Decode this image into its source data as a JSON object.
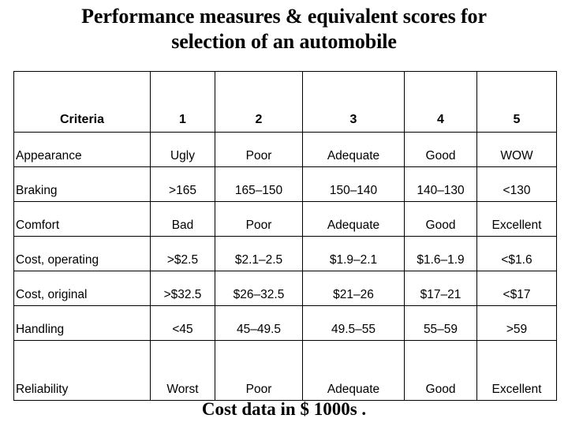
{
  "title": {
    "line1": "Performance measures & equivalent scores for",
    "line2": "selection of an automobile"
  },
  "footer": {
    "caption": "Cost data in $ 1000s ."
  },
  "table": {
    "headers": [
      "Criteria",
      "1",
      "2",
      "3",
      "4",
      "5"
    ],
    "rows": [
      {
        "criteria": "Appearance",
        "values": [
          "Ugly",
          "Poor",
          "Adequate",
          "Good",
          "WOW"
        ]
      },
      {
        "criteria": "Braking",
        "values": [
          ">165",
          "165–150",
          "150–140",
          "140–130",
          "<130"
        ]
      },
      {
        "criteria": "Comfort",
        "values": [
          "Bad",
          "Poor",
          "Adequate",
          "Good",
          "Excellent"
        ]
      },
      {
        "criteria": "Cost, operating",
        "values": [
          ">$2.5",
          "$2.1–2.5",
          "$1.9–2.1",
          "$1.6–1.9",
          "<$1.6"
        ]
      },
      {
        "criteria": "Cost, original",
        "values": [
          ">$32.5",
          "$26–32.5",
          "$21–26",
          "$17–21",
          "<$17"
        ]
      },
      {
        "criteria": "Handling",
        "values": [
          "<45",
          "45–49.5",
          "49.5–55",
          "55–59",
          ">59"
        ]
      },
      {
        "criteria": "Reliability",
        "values": [
          "Worst",
          "Poor",
          "Adequate",
          "Good",
          "Excellent"
        ]
      }
    ]
  },
  "colors": {
    "background": "#ffffff",
    "text": "#000000",
    "border": "#000000"
  }
}
